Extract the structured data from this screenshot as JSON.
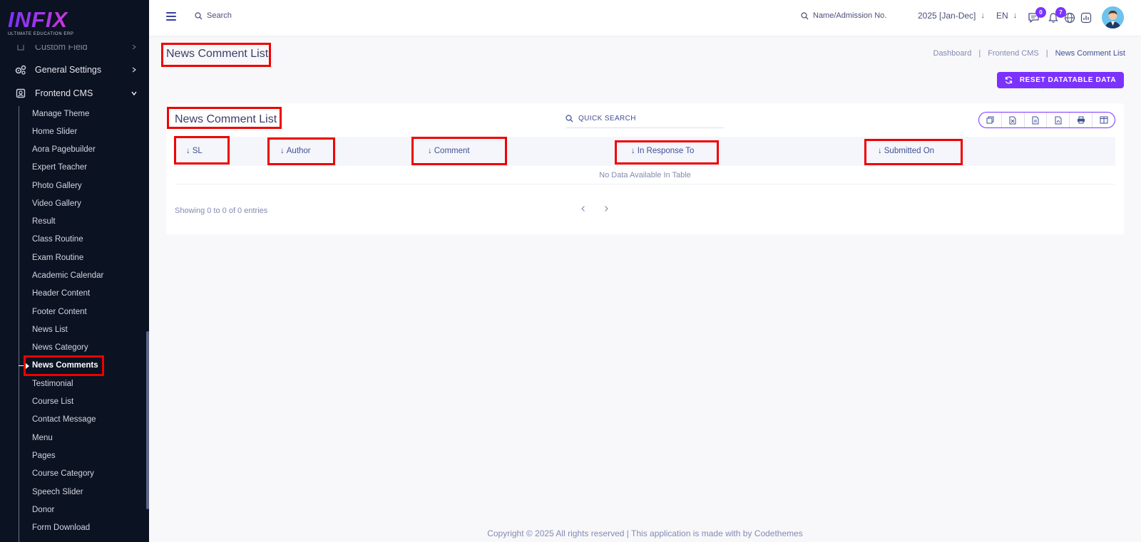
{
  "app": {
    "logo_text": "INFIX",
    "logo_subtitle": "ULTIMATE EDUCATION ERP"
  },
  "sidebar": {
    "top_partial_label": "Custom Field",
    "items": [
      {
        "label": "General Settings",
        "icon": "gears-icon"
      },
      {
        "label": "Frontend CMS",
        "icon": "cms-icon",
        "expanded": true
      }
    ],
    "submenu": [
      "Manage Theme",
      "Home Slider",
      "Aora Pagebuilder",
      "Expert Teacher",
      "Photo Gallery",
      "Video Gallery",
      "Result",
      "Class Routine",
      "Exam Routine",
      "Academic Calendar",
      "Header Content",
      "Footer Content",
      "News List",
      "News Category",
      "News Comments",
      "Testimonial",
      "Course List",
      "Contact Message",
      "Menu",
      "Pages",
      "Course Category",
      "Speech Slider",
      "Donor",
      "Form Download"
    ],
    "active_submenu": "News Comments"
  },
  "topbar": {
    "search_placeholder": "Search",
    "name_search_placeholder": "Name/Admission No.",
    "year": "2025 [Jan-Dec]",
    "language": "EN",
    "messages_count": "0",
    "notifications_count": "7"
  },
  "page": {
    "title": "News Comment List",
    "breadcrumb": [
      "Dashboard",
      "Frontend CMS",
      "News Comment List"
    ],
    "reset_button": "RESET DATATABLE DATA"
  },
  "table": {
    "title": "News Comment List",
    "quick_search_placeholder": "QUICK SEARCH",
    "columns": [
      "SL",
      "Author",
      "Comment",
      "In Response To",
      "Submitted On"
    ],
    "empty_message": "No Data Available In Table",
    "showing_text": "Showing 0 to 0 of 0 entries",
    "export_buttons": [
      "copy-icon",
      "excel-icon",
      "csv-icon",
      "pdf-icon",
      "print-icon",
      "columns-icon"
    ]
  },
  "footer": {
    "text": "Copyright © 2025 All rights reserved | This application is made with by Codethemes"
  },
  "colors": {
    "sidebar_bg": "#0b1221",
    "accent": "#7c32ff",
    "highlight": "#ee0000"
  }
}
